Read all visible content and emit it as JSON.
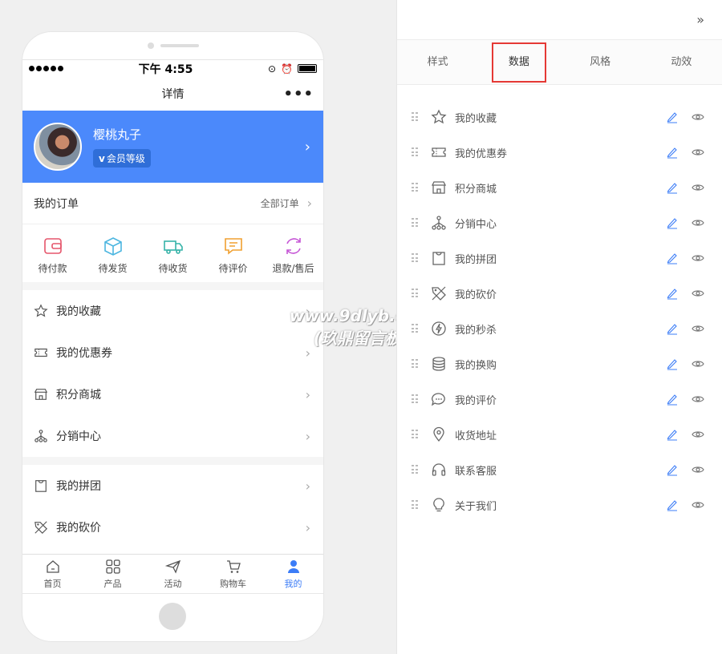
{
  "phone": {
    "status": {
      "time": "下午 4:55"
    },
    "nav": {
      "title": "详情",
      "more": "•••"
    },
    "profile": {
      "name": "樱桃丸子",
      "badge_v": "v",
      "badge": "会员等级"
    },
    "orders": {
      "title": "我的订单",
      "all": "全部订单",
      "items": [
        {
          "label": "待付款",
          "icon": "wallet-icon"
        },
        {
          "label": "待发货",
          "icon": "box-icon"
        },
        {
          "label": "待收货",
          "icon": "truck-icon"
        },
        {
          "label": "待评价",
          "icon": "comment-icon"
        },
        {
          "label": "退款/售后",
          "icon": "refund-icon"
        }
      ]
    },
    "group1": [
      "我的收藏",
      "我的优惠券",
      "积分商城",
      "分销中心"
    ],
    "group2": [
      "我的拼团",
      "我的砍价"
    ],
    "tabbar": [
      {
        "label": "首页",
        "icon": "home-icon"
      },
      {
        "label": "产品",
        "icon": "grid-icon"
      },
      {
        "label": "活动",
        "icon": "send-icon"
      },
      {
        "label": "购物车",
        "icon": "cart-icon"
      },
      {
        "label": "我的",
        "icon": "user-icon"
      }
    ]
  },
  "watermark": {
    "line1": "www.9dlyb.com",
    "line2": "(玖鼎留言板)"
  },
  "panel": {
    "collapse": "»",
    "tabs": [
      "样式",
      "数据",
      "风格",
      "动效"
    ],
    "items": [
      {
        "label": "我的收藏",
        "icon": "star-icon"
      },
      {
        "label": "我的优惠券",
        "icon": "coupon-icon"
      },
      {
        "label": "积分商城",
        "icon": "store-icon"
      },
      {
        "label": "分销中心",
        "icon": "network-icon"
      },
      {
        "label": "我的拼团",
        "icon": "bag-icon"
      },
      {
        "label": "我的砍价",
        "icon": "price-tag-icon"
      },
      {
        "label": "我的秒杀",
        "icon": "flash-icon"
      },
      {
        "label": "我的换购",
        "icon": "coins-icon"
      },
      {
        "label": "我的评价",
        "icon": "chat-icon"
      },
      {
        "label": "收货地址",
        "icon": "location-icon"
      },
      {
        "label": "联系客服",
        "icon": "headset-icon"
      },
      {
        "label": "关于我们",
        "icon": "bulb-icon"
      }
    ]
  },
  "colors": {
    "brand": "#4b89fb",
    "active_tab": "#3b7cf7",
    "highlight": "#e53935"
  }
}
